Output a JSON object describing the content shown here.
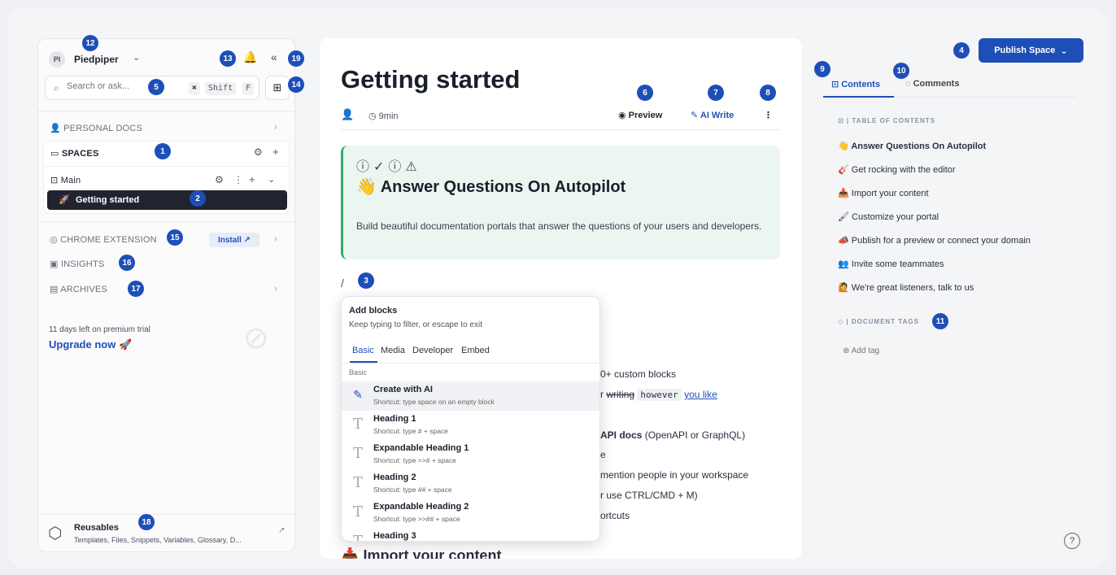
{
  "sidebar": {
    "workspace_initials": "PI",
    "workspace_name": "Piedpiper",
    "search": {
      "placeholder": "Search or ask...",
      "shortcut_x": "✖",
      "shortcut_shift": "Shift",
      "shortcut_f": "F"
    },
    "personal_docs": "PERSONAL DOCS",
    "spaces": "SPACES",
    "main": "Main",
    "active_page": "Getting started",
    "chrome_extension": "CHROME EXTENSION",
    "install": "Install",
    "insights": "INSIGHTS",
    "archives": "ARCHIVES",
    "trial": "11 days left on premium trial",
    "upgrade": "Upgrade now",
    "reusables_title": "Reusables",
    "reusables_sub": "Templates, Files, Snippets, Variables, Glossary, D..."
  },
  "editor": {
    "title": "Getting started",
    "read_time": "9min",
    "preview": "Preview",
    "ai_write": "AI Write",
    "hint_title": "Answer Questions On Autopilot",
    "hint_body": "Build beautiful documentation portals that answer the questions of your users and developers.",
    "bg_lines": [
      "0+ custom blocks",
      "r",
      "writing",
      "however",
      "you like",
      "API docs",
      "(OpenAPI or GraphQL)",
      "e",
      "mention people in your workspace",
      "r use CTRL/CMD + M)",
      "ortcuts",
      "Import your content"
    ]
  },
  "popup": {
    "title": "Add blocks",
    "subtitle": "Keep typing to filter, or escape to exit",
    "tabs": [
      "Basic",
      "Media",
      "Developer",
      "Embed"
    ],
    "group": "Basic",
    "items": [
      {
        "label": "Create with AI",
        "shortcut": "Shortcut: type space on an empty block"
      },
      {
        "label": "Heading 1",
        "shortcut": "Shortcut: type # + space"
      },
      {
        "label": "Expandable Heading 1",
        "shortcut": "Shortcut: type >># + space"
      },
      {
        "label": "Heading 2",
        "shortcut": "Shortcut: type ## + space"
      },
      {
        "label": "Expandable Heading 2",
        "shortcut": "Shortcut: type >>## + space"
      },
      {
        "label": "Heading 3",
        "shortcut": ""
      }
    ]
  },
  "right": {
    "publish": "Publish Space",
    "tab_contents": "Contents",
    "tab_comments": "Comments",
    "toc_heading": "TABLE OF CONTENTS",
    "toc": [
      "Answer Questions On Autopilot",
      "Get rocking with the editor",
      "Import your content",
      "Customize your portal",
      "Publish for a preview or connect your domain",
      "Invite some teammates",
      "We're great listeners, talk to us"
    ],
    "tags_heading": "DOCUMENT TAGS",
    "add_tag": "Add tag"
  },
  "badges": [
    "1",
    "2",
    "3",
    "4",
    "5",
    "6",
    "7",
    "8",
    "9",
    "10",
    "11",
    "12",
    "13",
    "14",
    "15",
    "16",
    "17",
    "18",
    "19"
  ],
  "colors": {
    "accent": "#1e4fb8",
    "callout_bg": "#eaf6ef",
    "callout_border": "#2eae6e",
    "active_item": "#1f2430"
  }
}
